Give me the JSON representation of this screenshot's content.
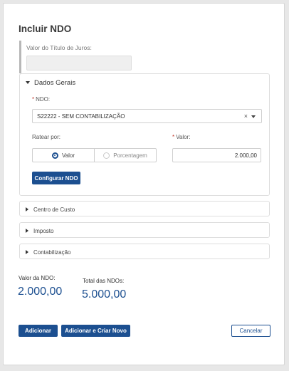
{
  "dialog": {
    "title": "Incluir NDO",
    "juros_label": "Valor do Título de Juros:",
    "juros_value": ""
  },
  "general": {
    "section_title": "Dados Gerais",
    "ndo_required_mark": "*",
    "ndo_label": "NDO:",
    "ndo_selected": "S22222 - SEM CONTABILIZAÇÃO",
    "clear_glyph": "×",
    "ratear_label": "Ratear por:",
    "ratear_options": [
      {
        "label": "Valor",
        "selected": true
      },
      {
        "label": "Porcentagem",
        "selected": false
      }
    ],
    "valor_required_mark": "*",
    "valor_label": "Valor:",
    "valor_value": "2.000,00",
    "config_button": "Configurar NDO"
  },
  "sections": [
    {
      "label": "Centro de Custo"
    },
    {
      "label": "Imposto"
    },
    {
      "label": "Contabilização"
    }
  ],
  "totals": {
    "ndo_label": "Valor da NDO:",
    "ndo_value": "2.000,00",
    "total_label": "Total das NDOs:",
    "total_value": "5.000,00"
  },
  "footer": {
    "add": "Adicionar",
    "add_new": "Adicionar e Criar Novo",
    "cancel": "Cancelar"
  },
  "colors": {
    "primary": "#1c4f90",
    "required": "#c0392b"
  }
}
